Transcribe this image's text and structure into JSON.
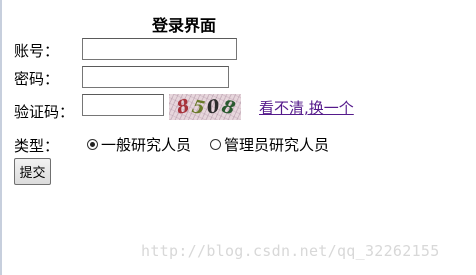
{
  "form": {
    "title": "登录界面",
    "account_label": "账号：",
    "account_value": "",
    "password_label": "密码：",
    "password_value": "",
    "captcha_label": "验证码：",
    "captcha_value": "",
    "captcha_text": "8508",
    "swap_link": "看不清,换一个",
    "type_label": "类型：",
    "types": [
      {
        "label": "一般研究人员",
        "checked": true
      },
      {
        "label": "管理员研究人员",
        "checked": false
      }
    ],
    "submit_label": "提交"
  },
  "watermark": "http://blog.csdn.net/qq_32262155",
  "colors": {
    "link": "#551a8b",
    "captcha_bg": "#e7d6dc",
    "watermark": "#d8d8d8"
  }
}
